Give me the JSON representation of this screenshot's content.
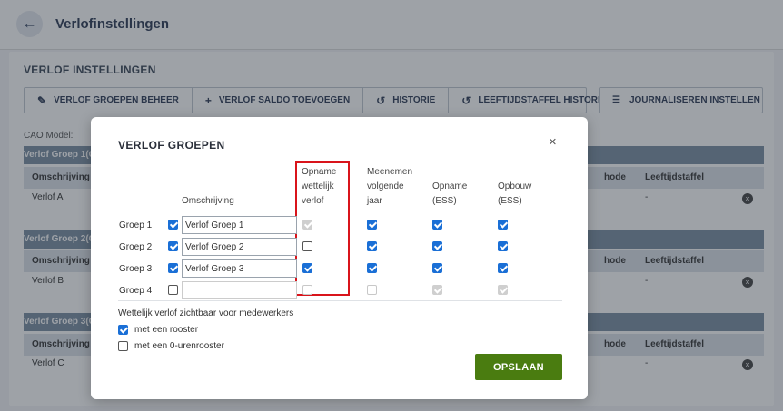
{
  "header": {
    "title": "Verlofinstellingen",
    "back_icon": "arrow-left-icon"
  },
  "section": {
    "title": "VERLOF INSTELLINGEN"
  },
  "toolbar": {
    "groepen_beheer": "VERLOF GROEPEN BEHEER",
    "saldo_toevoegen": "VERLOF SALDO TOEVOEGEN",
    "historie": "HISTORIE",
    "leeftijdstaffel_historie": "LEEFTIJDSTAFFEL HISTORIE",
    "journaliseren": "JOURNALISEREN INSTELLEN"
  },
  "cao_label": "CAO Model:",
  "background_groups": [
    {
      "header": "Verlof Groep 1(G",
      "col_omschrijving": "Omschrijving",
      "col_methode": "hode",
      "col_leeftijdstaffel": "Leeftijdstaffel",
      "row_name": "Verlof A",
      "row_value": "-"
    },
    {
      "header": "Verlof Groep 2(G",
      "col_omschrijving": "Omschrijving",
      "col_methode": "hode",
      "col_leeftijdstaffel": "Leeftijdstaffel",
      "row_name": "Verlof B",
      "row_value": "-"
    },
    {
      "header": "Verlof Groep 3(G",
      "col_omschrijving": "Omschrijving",
      "col_methode": "hode",
      "col_leeftijdstaffel": "Leeftijdstaffel",
      "row_name": "Verlof C",
      "row_value": "-"
    }
  ],
  "modal": {
    "title": "VERLOF GROEPEN",
    "close_icon": "close-icon",
    "headers": {
      "omschrijving": "Omschrijving",
      "opname_wettelijk_line1": "Opname",
      "opname_wettelijk_line2": "wettelijk",
      "opname_wettelijk_line3": "verlof",
      "meenemen_line1": "Meenemen",
      "meenemen_line2": "volgende",
      "meenemen_line3": "jaar",
      "opname_ess_line1": "Opname",
      "opname_ess_line2": "(ESS)",
      "opbouw_ess_line1": "Opbouw",
      "opbouw_ess_line2": "(ESS)"
    },
    "groups": [
      {
        "label": "Groep 1",
        "enabled": true,
        "name": "Verlof Groep 1",
        "opname_wettelijk": true,
        "opname_wettelijk_disabled": true,
        "meenemen": true,
        "opname_ess": true,
        "opbouw_ess": true,
        "disabled": false
      },
      {
        "label": "Groep 2",
        "enabled": true,
        "name": "Verlof Groep 2",
        "opname_wettelijk": false,
        "opname_wettelijk_disabled": false,
        "meenemen": true,
        "opname_ess": true,
        "opbouw_ess": true,
        "disabled": false
      },
      {
        "label": "Groep 3",
        "enabled": true,
        "name": "Verlof Groep 3",
        "opname_wettelijk": true,
        "opname_wettelijk_disabled": false,
        "meenemen": true,
        "opname_ess": true,
        "opbouw_ess": true,
        "disabled": false
      },
      {
        "label": "Groep 4",
        "enabled": false,
        "name": "",
        "opname_wettelijk": false,
        "opname_wettelijk_disabled": true,
        "meenemen": false,
        "opname_ess": true,
        "opbouw_ess": true,
        "disabled": true
      }
    ],
    "visibility_label": "Wettelijk verlof zichtbaar voor medewerkers",
    "options": [
      {
        "label": "met een rooster",
        "checked": true
      },
      {
        "label": "met een 0-urenrooster",
        "checked": false
      }
    ],
    "save_label": "OPSLAAN"
  },
  "colors": {
    "primary": "#1a6fd6",
    "save": "#4a7c10",
    "highlight": "#d9141b",
    "group_header": "#7a8ea3"
  }
}
